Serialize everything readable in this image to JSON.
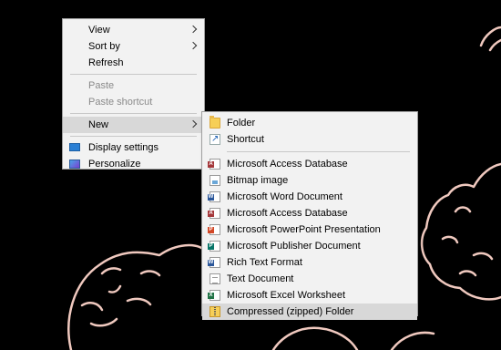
{
  "colors": {
    "menu_bg": "#f2f2f2",
    "hover_bg": "#d8d8d8",
    "disabled_text": "#8a8a8a",
    "wallpaper_line": "#f0c9bf"
  },
  "context_menu": {
    "items": [
      {
        "label": "View",
        "submenu": true
      },
      {
        "label": "Sort by",
        "submenu": true
      },
      {
        "label": "Refresh"
      },
      {
        "label": "Paste",
        "disabled": true
      },
      {
        "label": "Paste shortcut",
        "disabled": true
      },
      {
        "label": "New",
        "submenu": true,
        "active": true
      },
      {
        "label": "Display settings",
        "icon": "display-icon"
      },
      {
        "label": "Personalize",
        "icon": "personalize-icon"
      }
    ]
  },
  "new_submenu": {
    "items": [
      {
        "label": "Folder",
        "icon": "folder-icon"
      },
      {
        "label": "Shortcut",
        "icon": "shortcut-icon"
      },
      {
        "label": "Microsoft Access Database",
        "icon": "access-icon",
        "badge": "A",
        "color": "#a4373a"
      },
      {
        "label": "Bitmap image",
        "icon": "bitmap-icon"
      },
      {
        "label": "Microsoft Word Document",
        "icon": "word-icon",
        "badge": "W",
        "color": "#2b579a"
      },
      {
        "label": "Microsoft Access Database",
        "icon": "access-icon",
        "badge": "A",
        "color": "#a4373a"
      },
      {
        "label": "Microsoft PowerPoint Presentation",
        "icon": "powerpoint-icon",
        "badge": "P",
        "color": "#d24726"
      },
      {
        "label": "Microsoft Publisher Document",
        "icon": "publisher-icon",
        "badge": "P",
        "color": "#077568"
      },
      {
        "label": "Rich Text Format",
        "icon": "wordpad-icon",
        "badge": "W",
        "color": "#2b579a"
      },
      {
        "label": "Text Document",
        "icon": "text-icon"
      },
      {
        "label": "Microsoft Excel Worksheet",
        "icon": "excel-icon",
        "badge": "X",
        "color": "#217346"
      },
      {
        "label": "Compressed (zipped) Folder",
        "icon": "zip-folder-icon",
        "hover": true
      }
    ]
  }
}
